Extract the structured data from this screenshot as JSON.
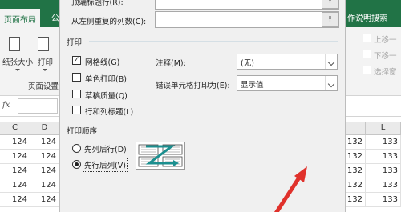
{
  "ribbon": {
    "tabs": {
      "page_layout": "页面布局",
      "formula_partial": "公",
      "help_search": "作说明搜索"
    },
    "buttons": {
      "paper_size": "纸张大小",
      "print_area_partial": "打印",
      "bring_forward": "上移一",
      "send_backward": "下移一",
      "selection_pane": "选择窗"
    },
    "group_page_setup": "页面设置"
  },
  "formula_bar": {
    "fx": "fx"
  },
  "sheet": {
    "columns_left": [
      "C",
      "D"
    ],
    "columns_right": [
      "L"
    ],
    "rows": [
      {
        "c": "124",
        "d": "124",
        "l1": "132",
        "l2": "133"
      },
      {
        "c": "124",
        "d": "124",
        "l1": "132",
        "l2": "133"
      },
      {
        "c": "124",
        "d": "124",
        "l1": "132",
        "l2": "133"
      },
      {
        "c": "124",
        "d": "124",
        "l1": "132",
        "l2": "133"
      },
      {
        "c": "124",
        "d": "124",
        "l1": "132",
        "l2": "133"
      }
    ]
  },
  "dialog": {
    "title_rows_label": "顶端标题行(R):",
    "title_cols_label": "从左侧重复的列数(C):",
    "print_section": "打印",
    "gridlines": "网格线(G)",
    "monochrome": "单色打印(B)",
    "draft_quality": "草稿质量(Q)",
    "row_col_headings": "行和列标题(L)",
    "comments_label": "注释(M):",
    "comments_value": "(无)",
    "cell_errors_label": "错误单元格打印为(E):",
    "cell_errors_value": "显示值",
    "page_order_section": "打印顺序",
    "down_then_over": "先列后行(D)",
    "over_then_down": "先行后列(V)",
    "upload_icon_glyph": "⭱"
  },
  "colors": {
    "ribbon_green": "#217346",
    "arrow_red": "#e0312b",
    "order_teal": "#1c8f8f"
  }
}
